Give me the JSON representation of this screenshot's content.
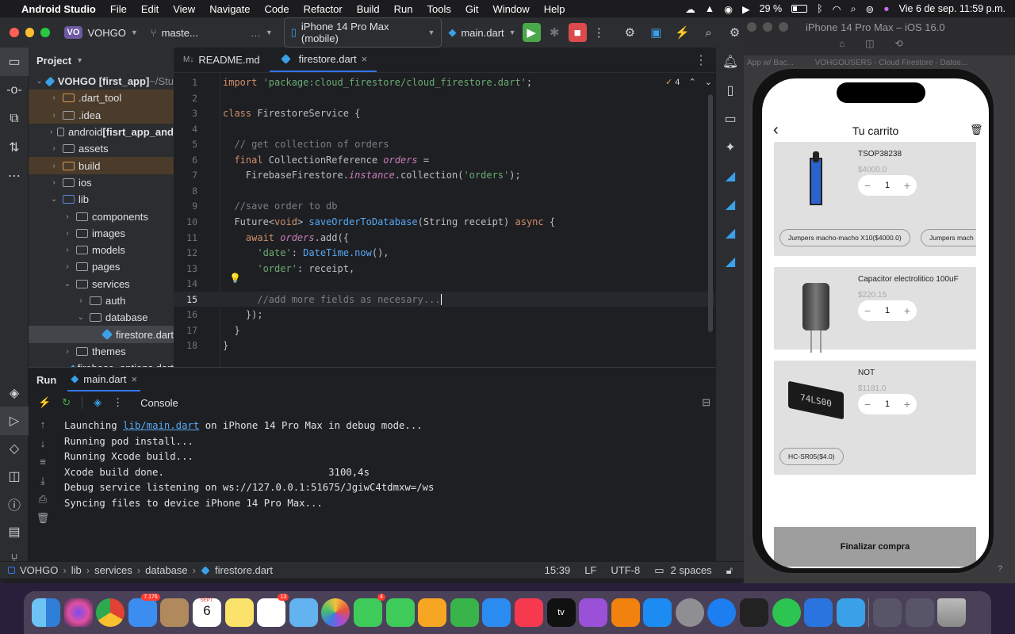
{
  "menubar": {
    "app": "Android Studio",
    "items": [
      "File",
      "Edit",
      "View",
      "Navigate",
      "Code",
      "Refactor",
      "Build",
      "Run",
      "Tools",
      "Git",
      "Window",
      "Help"
    ],
    "battery": "29 %",
    "datetime": "Vie 6 de sep.  11:59 p.m."
  },
  "toolbar": {
    "project_badge": "VO",
    "project_name": "VOHGO",
    "branch": "maste...",
    "device": "iPhone 14 Pro Max (mobile)",
    "run_config": "main.dart"
  },
  "project_pane": {
    "title": "Project",
    "tree": [
      {
        "label": "VOHGO [first_app]",
        "suffix": " ~/Stu",
        "indent": 0,
        "arrow": "v",
        "icon": "module",
        "bold": true
      },
      {
        "label": ".dart_tool",
        "indent": 1,
        "arrow": ">",
        "icon": "folder-orange",
        "hl": "orange"
      },
      {
        "label": ".idea",
        "indent": 1,
        "arrow": ">",
        "icon": "folder",
        "hl": "orange"
      },
      {
        "label": "android",
        "suffix": " [fisrt_app_and",
        "indent": 1,
        "arrow": ">",
        "icon": "folder"
      },
      {
        "label": "assets",
        "indent": 1,
        "arrow": ">",
        "icon": "folder"
      },
      {
        "label": "build",
        "indent": 1,
        "arrow": ">",
        "icon": "folder-orange",
        "hl": "orange"
      },
      {
        "label": "ios",
        "indent": 1,
        "arrow": ">",
        "icon": "folder"
      },
      {
        "label": "lib",
        "indent": 1,
        "arrow": "v",
        "icon": "folder-blue"
      },
      {
        "label": "components",
        "indent": 2,
        "arrow": ">",
        "icon": "folder"
      },
      {
        "label": "images",
        "indent": 2,
        "arrow": ">",
        "icon": "folder"
      },
      {
        "label": "models",
        "indent": 2,
        "arrow": ">",
        "icon": "folder"
      },
      {
        "label": "pages",
        "indent": 2,
        "arrow": ">",
        "icon": "folder"
      },
      {
        "label": "services",
        "indent": 2,
        "arrow": "v",
        "icon": "folder"
      },
      {
        "label": "auth",
        "indent": 3,
        "arrow": ">",
        "icon": "folder"
      },
      {
        "label": "database",
        "indent": 3,
        "arrow": "v",
        "icon": "folder"
      },
      {
        "label": "firestore.dart",
        "indent": 4,
        "arrow": "",
        "icon": "dart",
        "hl": "sel"
      },
      {
        "label": "themes",
        "indent": 2,
        "arrow": ">",
        "icon": "folder"
      },
      {
        "label": "firebase_options.dart",
        "indent": 2,
        "arrow": "",
        "icon": "dart"
      }
    ]
  },
  "editor": {
    "tabs": [
      {
        "label": "README.md",
        "icon": "M↓",
        "active": false
      },
      {
        "label": "firestore.dart",
        "icon": "dart",
        "active": true
      }
    ],
    "warnings": "4",
    "current_line": 15,
    "lines": [
      [
        [
          "kw",
          "import "
        ],
        [
          "str",
          "'package:cloud_firestore/cloud_firestore.dart'"
        ],
        [
          "cls",
          ";"
        ]
      ],
      [],
      [
        [
          "kw",
          "class "
        ],
        [
          "cls",
          "FirestoreService {"
        ]
      ],
      [],
      [
        [
          "cmt",
          "  // get collection of orders"
        ]
      ],
      [
        [
          "kw",
          "  final "
        ],
        [
          "cls",
          "CollectionReference "
        ],
        [
          "it",
          "orders"
        ],
        [
          "cls",
          " ="
        ]
      ],
      [
        [
          "cls",
          "    FirebaseFirestore."
        ],
        [
          "it",
          "instance"
        ],
        [
          "cls",
          ".collection("
        ],
        [
          "str",
          "'orders'"
        ],
        [
          "cls",
          ");"
        ]
      ],
      [],
      [
        [
          "cmt",
          "  //save order to db"
        ]
      ],
      [
        [
          "cls",
          "  Future<"
        ],
        [
          "kw",
          "void"
        ],
        [
          "cls",
          "> "
        ],
        [
          "fn",
          "saveOrderToDatabase"
        ],
        [
          "cls",
          "(String receipt) "
        ],
        [
          "kw",
          "async"
        ],
        [
          "cls",
          " {"
        ]
      ],
      [
        [
          "kw",
          "    await "
        ],
        [
          "it",
          "orders"
        ],
        [
          "cls",
          ".add({"
        ]
      ],
      [
        [
          "str",
          "      'date'"
        ],
        [
          "cls",
          ": "
        ],
        [
          "fn",
          "DateTime.now"
        ],
        [
          "cls",
          "(),"
        ]
      ],
      [
        [
          "str",
          "      'order'"
        ],
        [
          "cls",
          ": receipt,"
        ]
      ],
      [],
      [
        [
          "cmt",
          "      //add more fields as necesary..."
        ]
      ],
      [
        [
          "cls",
          "    });"
        ]
      ],
      [
        [
          "cls",
          "  }"
        ]
      ],
      [
        [
          "cls",
          "}"
        ]
      ]
    ]
  },
  "run_panel": {
    "title": "Run",
    "tab": "main.dart",
    "console_label": "Console",
    "console": [
      {
        "pre": "Launching ",
        "link": "lib/main.dart",
        "post": " on iPhone 14 Pro Max in debug mode..."
      },
      {
        "pre": "Running pod install...",
        "link": "",
        "post": ""
      },
      {
        "pre": "Running Xcode build...",
        "link": "",
        "post": ""
      },
      {
        "pre": "Xcode build done.                            3100,4s",
        "link": "",
        "post": ""
      },
      {
        "pre": "Debug service listening on ws://127.0.0.1:51675/JgiwC4tdmxw=/ws",
        "link": "",
        "post": ""
      },
      {
        "pre": "Syncing files to device iPhone 14 Pro Max...",
        "link": "",
        "post": ""
      }
    ]
  },
  "status_bar": {
    "breadcrumb": [
      "VOHGO",
      "lib",
      "services",
      "database",
      "firestore.dart"
    ],
    "position": "15:39",
    "line_sep": "LF",
    "encoding": "UTF-8",
    "indent": "2 spaces"
  },
  "simulator": {
    "title": "iPhone 14 Pro Max – iOS 16.0",
    "bg_tabs": [
      "App w/ Bac...",
      "VOHGOUSERS - Cloud Firestore - Datos..."
    ],
    "app": {
      "title": "Tu carrito",
      "items": [
        {
          "name": "TSOP38238",
          "price": "$4000.0",
          "qty": "1",
          "chips": [
            "Jumpers macho-macho X10($4000.0)",
            "Jumpers mach"
          ]
        },
        {
          "name": "Capacitor electrolitico 100uF",
          "price": "$220.15",
          "qty": "1",
          "chips": []
        },
        {
          "name": "NOT",
          "price": "$1181.0",
          "qty": "1",
          "chips": [
            "HC-SR05($4.0)"
          ]
        }
      ],
      "checkout": "Finalizar compra"
    }
  },
  "dock": {
    "mail_badge": "7.176",
    "calendar_month": "SEPT.",
    "calendar_day": "6",
    "reminders_badge": "13",
    "messages_badge": "4"
  }
}
